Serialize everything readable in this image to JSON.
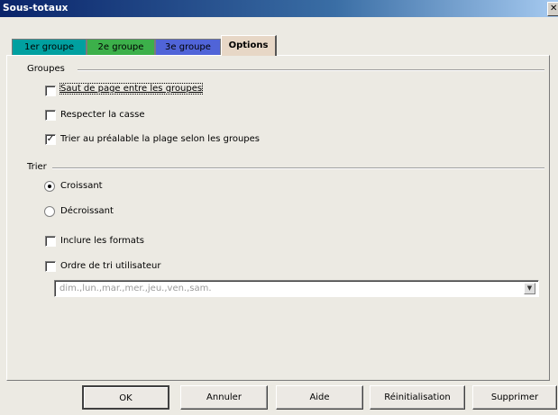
{
  "window": {
    "title": "Sous-totaux"
  },
  "tabs": [
    {
      "label": "1er groupe",
      "color": "#00a0a0"
    },
    {
      "label": "2e groupe",
      "color": "#3cb04a"
    },
    {
      "label": "3e groupe",
      "color": "#5064d8"
    },
    {
      "label": "Options",
      "color": "#e7d7c6",
      "active": true
    }
  ],
  "groupes": {
    "label": "Groupes",
    "options": [
      {
        "label": "Saut de page entre les groupes",
        "checked": false
      },
      {
        "label": "Respecter la casse",
        "checked": false
      },
      {
        "label": "Trier au préalable la plage selon les groupes",
        "checked": true
      }
    ]
  },
  "trier": {
    "label": "Trier",
    "order": [
      {
        "label": "Croissant",
        "selected": true
      },
      {
        "label": "Décroissant",
        "selected": false
      }
    ],
    "include_formats": {
      "label": "Inclure les formats",
      "checked": false
    },
    "user_order": {
      "label": "Ordre de tri utilisateur",
      "checked": false
    },
    "user_list_value": "dim.,lun.,mar.,mer.,jeu.,ven.,sam."
  },
  "buttons": {
    "ok": "OK",
    "cancel": "Annuler",
    "help": "Aide",
    "reset": "Réinitialisation",
    "delete": "Supprimer"
  }
}
